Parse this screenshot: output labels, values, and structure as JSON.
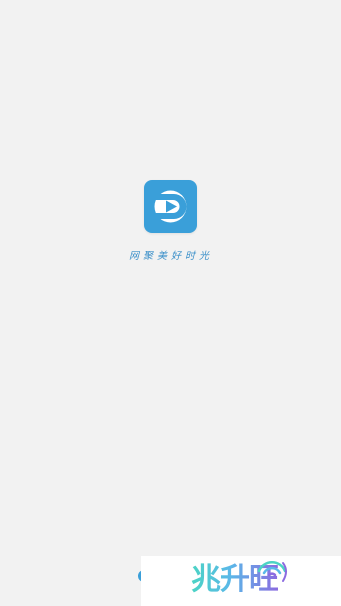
{
  "splash": {
    "slogan": "网聚美好时光",
    "icon": "app-logo-play-icon",
    "accent_color": "#3a9fd9"
  },
  "watermark": {
    "text": "兆升旺",
    "icon": "wifi-wave-icon"
  }
}
